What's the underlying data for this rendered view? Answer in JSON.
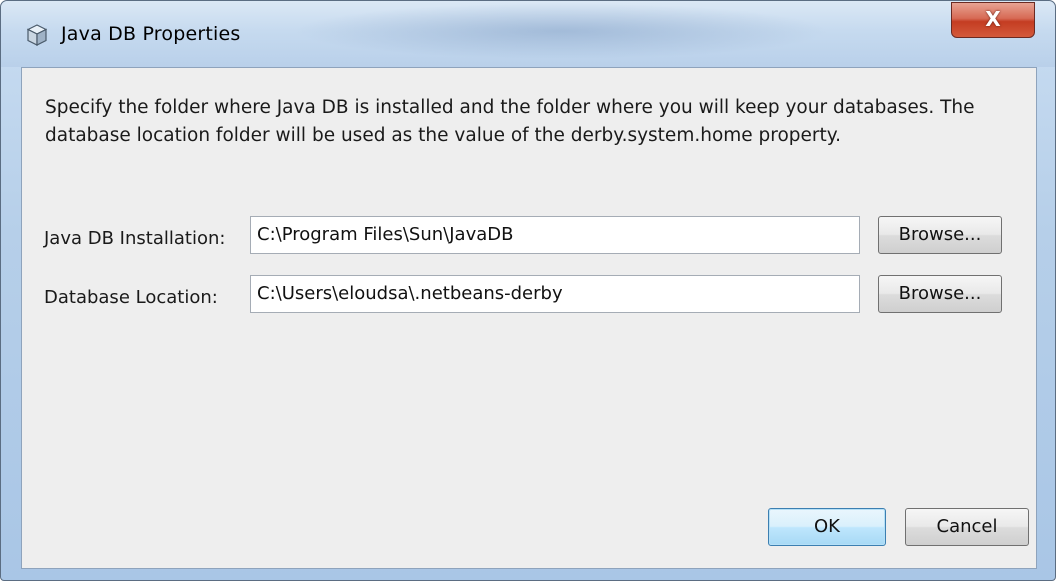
{
  "window": {
    "title": "Java DB Properties",
    "close_label": "X"
  },
  "description": "Specify the folder where Java DB is installed and the folder where you will keep your databases. The database location folder will be used as the value of the derby.system.home property.",
  "fields": [
    {
      "label": "Java DB Installation:",
      "value": "C:\\Program Files\\Sun\\JavaDB",
      "browse_label": "Browse..."
    },
    {
      "label": "Database Location:",
      "value": "C:\\Users\\eloudsa\\.netbeans-derby",
      "browse_label": "Browse..."
    }
  ],
  "buttons": {
    "ok_label": "OK",
    "cancel_label": "Cancel"
  },
  "icons": {
    "app": "cube-icon",
    "close": "close-icon"
  },
  "colors": {
    "title_bar": "#c6daef",
    "close_button": "#c43c22",
    "dialog_background": "#eeeeee",
    "default_button": "#bee6fd"
  }
}
